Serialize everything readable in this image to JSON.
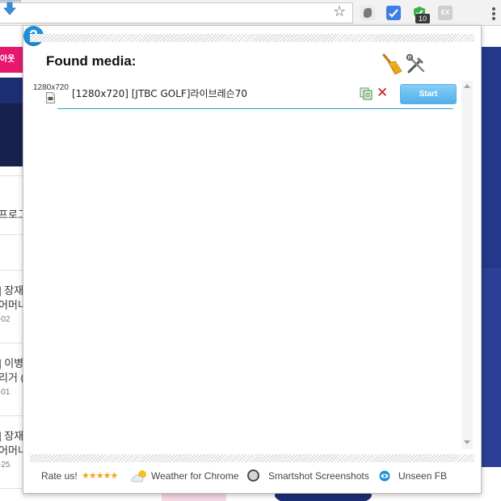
{
  "browser": {
    "extension_badge": "10",
    "gray_ext_label": "EX"
  },
  "background_page": {
    "pink_tab": "아웃",
    "texts": [
      "프로그",
      "] 장재",
      "어머니",
      "-02",
      "] 이병",
      "리거 (",
      "-01",
      "] 장재",
      "어머니",
      "-25"
    ]
  },
  "popup": {
    "title": "Found media:",
    "media": [
      {
        "resolution": "1280x720",
        "title": "[1280x720] [JTBC GOLF]라이브레슨70",
        "start_label": "Start"
      }
    ],
    "footer": {
      "rate_label": "Rate us!",
      "stars": "★★★★★",
      "links": [
        "Weather for Chrome",
        "Smartshot Screenshots",
        "Unseen FB"
      ]
    }
  },
  "colors": {
    "accent": "#4fb0ea",
    "delete": "#c81818",
    "help": "#1e8fd8",
    "underline": "#28a0cc"
  }
}
